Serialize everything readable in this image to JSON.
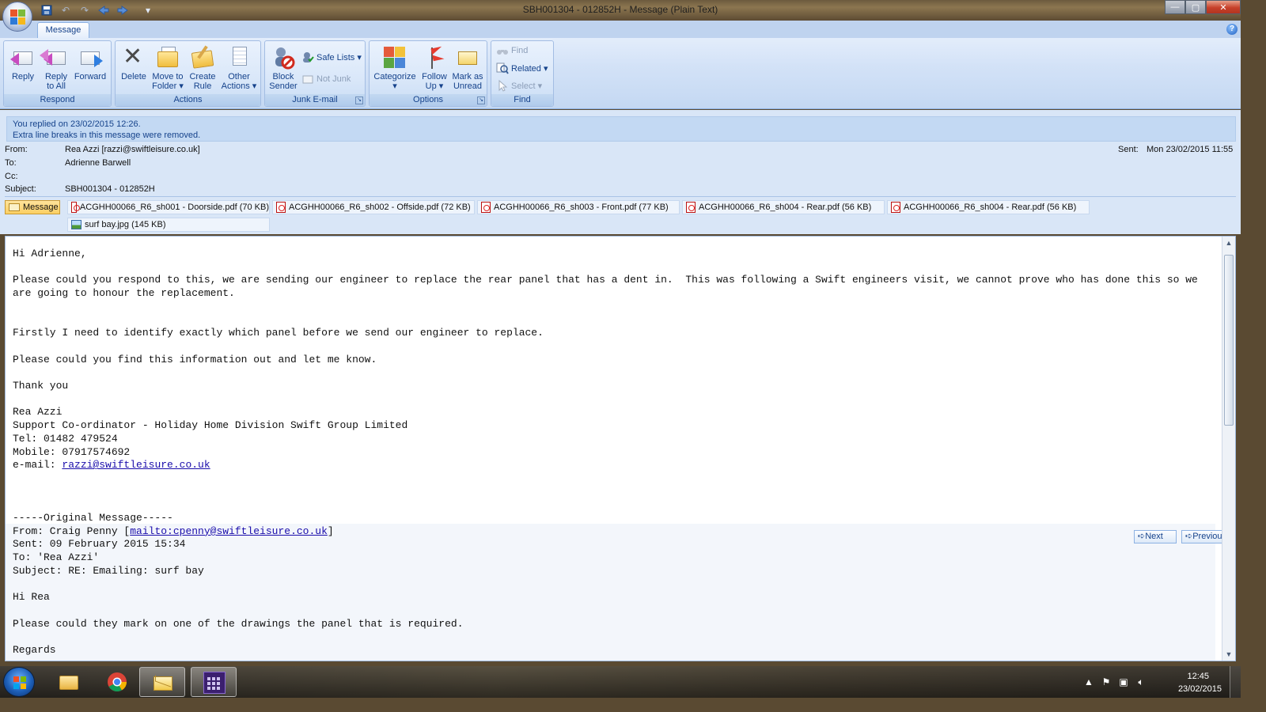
{
  "window": {
    "title": "SBH001304 - 012852H - Message (Plain Text)",
    "controls": {
      "minimize": "—",
      "maximize": "▢",
      "close": "✕"
    }
  },
  "quick_access": [
    {
      "name": "save-icon",
      "glyph": "💾"
    },
    {
      "name": "undo-icon",
      "glyph": "↶"
    },
    {
      "name": "redo-icon",
      "glyph": "↷"
    },
    {
      "name": "previous-item-icon",
      "glyph": "▲"
    },
    {
      "name": "next-item-icon",
      "glyph": "▼"
    },
    {
      "name": "customize-qat-icon",
      "glyph": "▾"
    }
  ],
  "ribbon": {
    "tabs": [
      {
        "label": "Message"
      }
    ],
    "help_glyph": "?",
    "groups": {
      "respond": {
        "label": "Respond",
        "buttons": [
          "Reply",
          "Reply\nto All",
          "Forward"
        ]
      },
      "actions": {
        "label": "Actions",
        "buttons": [
          "Delete",
          "Move to\nFolder ▾",
          "Create\nRule",
          "Other\nActions ▾"
        ]
      },
      "junk": {
        "label": "Junk E-mail",
        "big": "Block\nSender",
        "safe_lists": "Safe Lists ▾",
        "not_junk": "Not Junk"
      },
      "options": {
        "label": "Options",
        "buttons": [
          "Categorize\n▾",
          "Follow\nUp ▾",
          "Mark as\nUnread"
        ]
      },
      "find": {
        "label": "Find",
        "find": "Find",
        "related": "Related ▾",
        "select": "Select ▾"
      }
    }
  },
  "info": {
    "notice_line1": "You replied on 23/02/2015 12:26.",
    "notice_line2": "Extra line breaks in this message were removed.",
    "from_label": "From:",
    "from_value": "Rea Azzi [razzi@swiftleisure.co.uk]",
    "to_label": "To:",
    "to_value": "Adrienne Barwell",
    "cc_label": "Cc:",
    "cc_value": "",
    "subject_label": "Subject:",
    "subject_value": "SBH001304 - 012852H",
    "sent_label": "Sent:",
    "sent_value": "Mon 23/02/2015 11:55"
  },
  "attachments": [
    {
      "label": "Message",
      "type": "message",
      "selected": true
    },
    {
      "label": "ACGHH00066_R6_sh001 - Doorside.pdf (70 KB)",
      "type": "pdf"
    },
    {
      "label": "ACGHH00066_R6_sh002 - Offside.pdf (72 KB)",
      "type": "pdf"
    },
    {
      "label": "ACGHH00066_R6_sh003 - Front.pdf (77 KB)",
      "type": "pdf"
    },
    {
      "label": "ACGHH00066_R6_sh004 - Rear.pdf (56 KB)",
      "type": "pdf"
    },
    {
      "label": "ACGHH00066_R6_sh004 - Rear.pdf (56 KB)",
      "type": "pdf"
    },
    {
      "label": "surf bay.jpg (145 KB)",
      "type": "image"
    }
  ],
  "body": {
    "greeting": "Hi Adrienne,",
    "para1": "Please could you respond to this, we are sending our engineer to replace the rear panel that has a dent in.  This was following a Swift engineers visit, we cannot prove who has done this so we are going to honour the replacement.",
    "para2": "Firstly I need to identify exactly which panel before we send our engineer to replace.",
    "para3": "Please could you find this information out and let me know.",
    "thanks": "Thank you",
    "sig_name": "Rea Azzi",
    "sig_title": "Support Co-ordinator - Holiday Home Division Swift Group Limited",
    "sig_tel": "Tel: 01482 479524",
    "sig_mobile": "Mobile: 07917574692",
    "sig_email_label": "e-mail: ",
    "sig_email": "razzi@swiftleisure.co.uk",
    "orig_header": "-----Original Message-----",
    "orig_from_prefix": "From: Craig Penny [",
    "orig_from_link": "mailto:cpenny@swiftleisure.co.uk",
    "orig_from_suffix": "]",
    "orig_sent": "Sent: 09 February 2015 15:34",
    "orig_to": "To: 'Rea Azzi'",
    "orig_subject": "Subject: RE: Emailing: surf bay",
    "orig_greeting": "Hi Rea",
    "orig_para": "Please could they mark on one of the drawings the panel that is required.",
    "orig_regards": "Regards",
    "next_label": "Next",
    "previous_label": "Previous"
  },
  "taskbar": {
    "time": "12:45",
    "date": "23/02/2015",
    "apps": [
      "windows-explorer",
      "google-chrome",
      "microsoft-outlook",
      "calendar-app"
    ]
  }
}
